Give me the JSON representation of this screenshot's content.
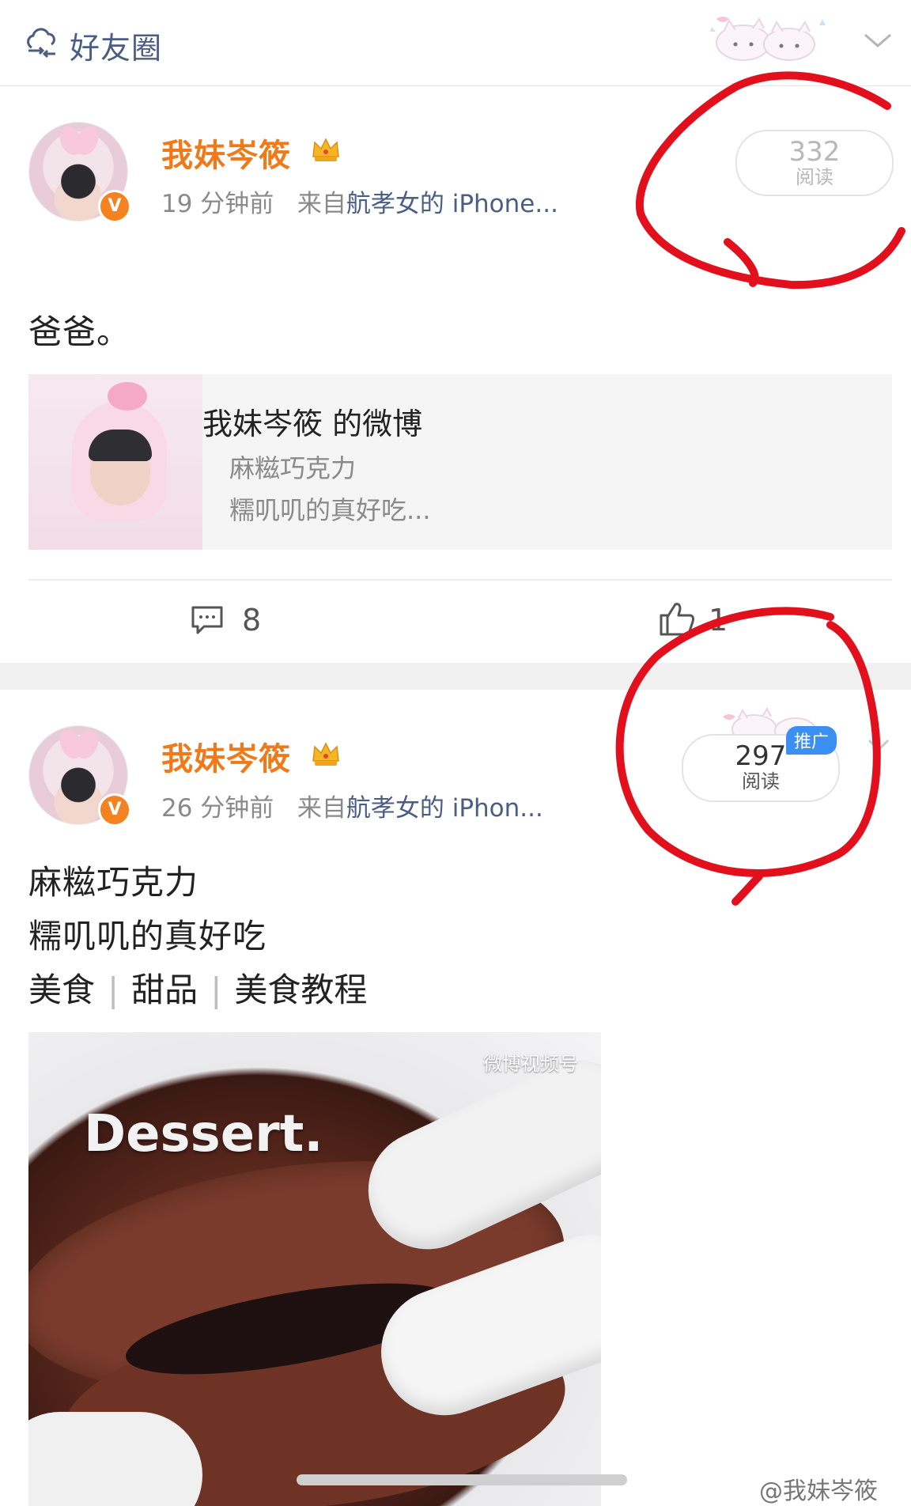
{
  "header": {
    "title": "好友圈",
    "icon": "cloud-group-icon"
  },
  "posts": [
    {
      "username": "我妹岑筱",
      "level_badge": "6",
      "time": "19 分钟前",
      "from_prefix": "来自",
      "source": "航孝女的 iPhone...",
      "reads": "332",
      "reads_label": "阅读",
      "text": "爸爸。",
      "card": {
        "title": "我妹岑筱 的微博",
        "line1": "麻糍巧克力",
        "line2": "糯叽叽的真好吃..."
      },
      "comments": "8",
      "likes": "1"
    },
    {
      "username": "我妹岑筱",
      "level_badge": "6",
      "time": "26 分钟前",
      "from_prefix": "来自",
      "source": "航孝女的 iPhon...",
      "reads": "297",
      "reads_label": "阅读",
      "promo": "推广",
      "text_line1": "麻糍巧克力",
      "text_line2": "糯叽叽的真好吃",
      "tags": [
        "美食",
        "甜品",
        "美食教程"
      ],
      "video": {
        "overlay_text": "Dessert.",
        "watermark": "微博视频号"
      }
    }
  ],
  "footer_watermark": "@我妹岑筱",
  "colors": {
    "username": "#f07a1a",
    "link": "#4a5d82",
    "annotation": "#e2101c",
    "promo": "#3a8ff0"
  }
}
